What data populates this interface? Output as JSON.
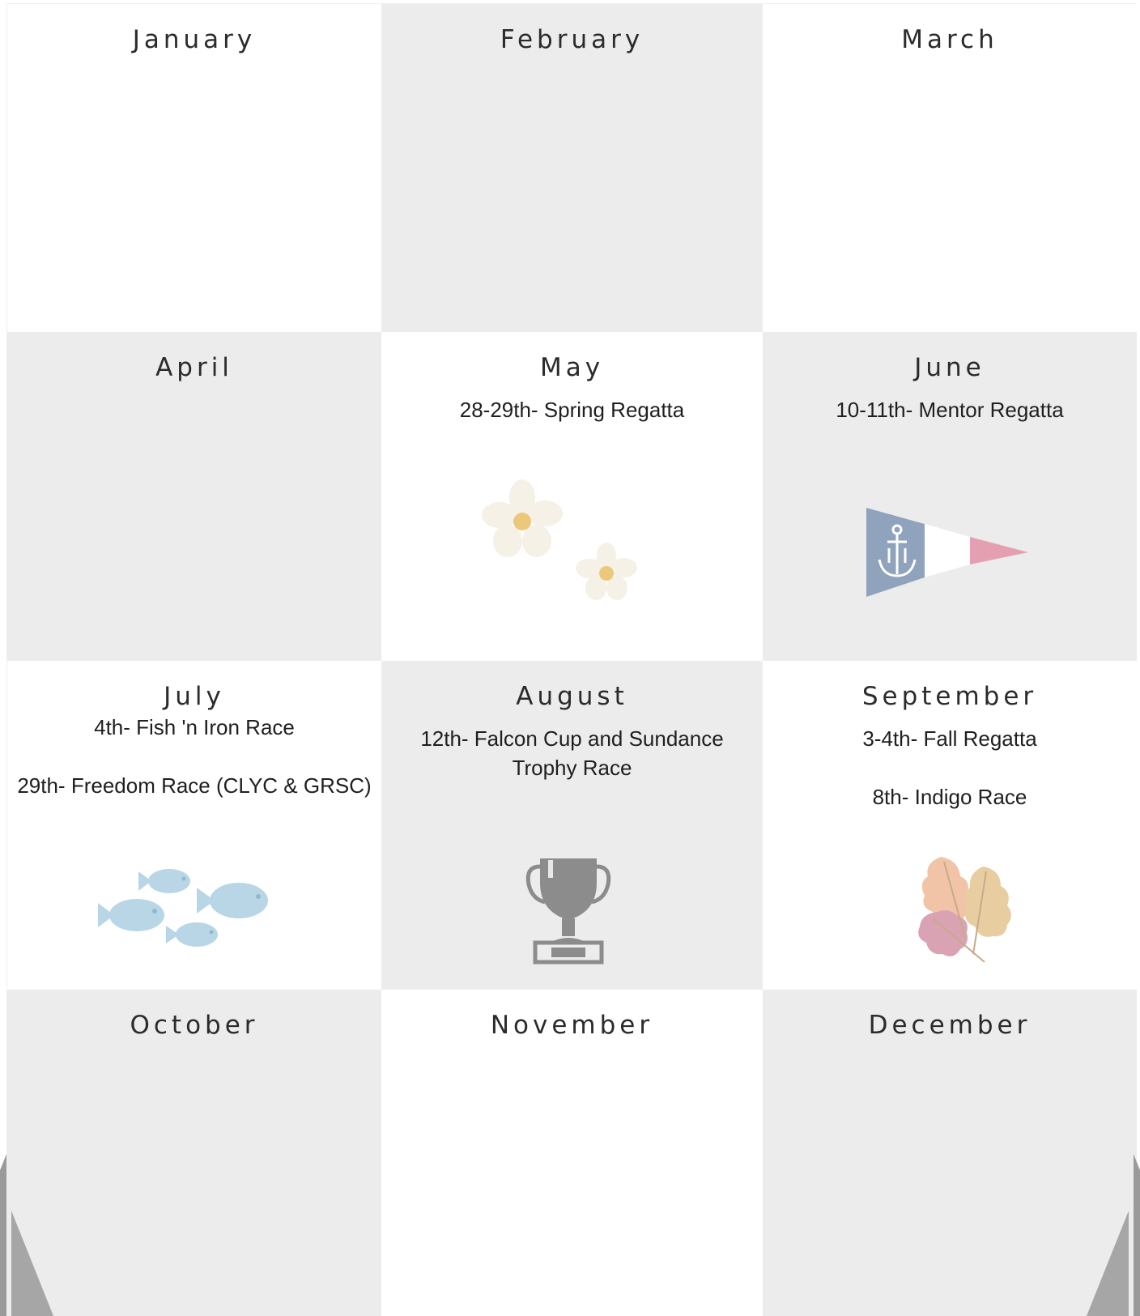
{
  "months": [
    {
      "name": "January",
      "events": []
    },
    {
      "name": "February",
      "events": []
    },
    {
      "name": "March",
      "events": []
    },
    {
      "name": "April",
      "events": []
    },
    {
      "name": "May",
      "events": [
        "28-29th- Spring Regatta"
      ]
    },
    {
      "name": "June",
      "events": [
        "10-11th- Mentor Regatta"
      ]
    },
    {
      "name": "July",
      "events": [
        "4th- Fish 'n Iron Race",
        "29th- Freedom Race (CLYC & GRSC)"
      ]
    },
    {
      "name": "August",
      "events": [
        "12th- Falcon Cup and Sundance Trophy Race"
      ]
    },
    {
      "name": "September",
      "events": [
        "3-4th- Fall Regatta",
        "8th- Indigo Race"
      ]
    },
    {
      "name": "October",
      "events": []
    },
    {
      "name": "November",
      "events": []
    },
    {
      "name": "December",
      "events": []
    }
  ],
  "illustrations": {
    "may": "daisy-flowers-icon",
    "june": "anchor-pennant-flag-icon",
    "july": "school-of-fish-icon",
    "august": "trophy-cup-icon",
    "september": "autumn-leaves-icon"
  },
  "colors": {
    "cell_grey": "#ececec",
    "cell_white": "#ffffff",
    "flag_blue": "#8fa3bc",
    "flag_pink": "#e4a0b0",
    "fish_blue": "#b9d6e6",
    "trophy_grey": "#8c8c8c"
  }
}
